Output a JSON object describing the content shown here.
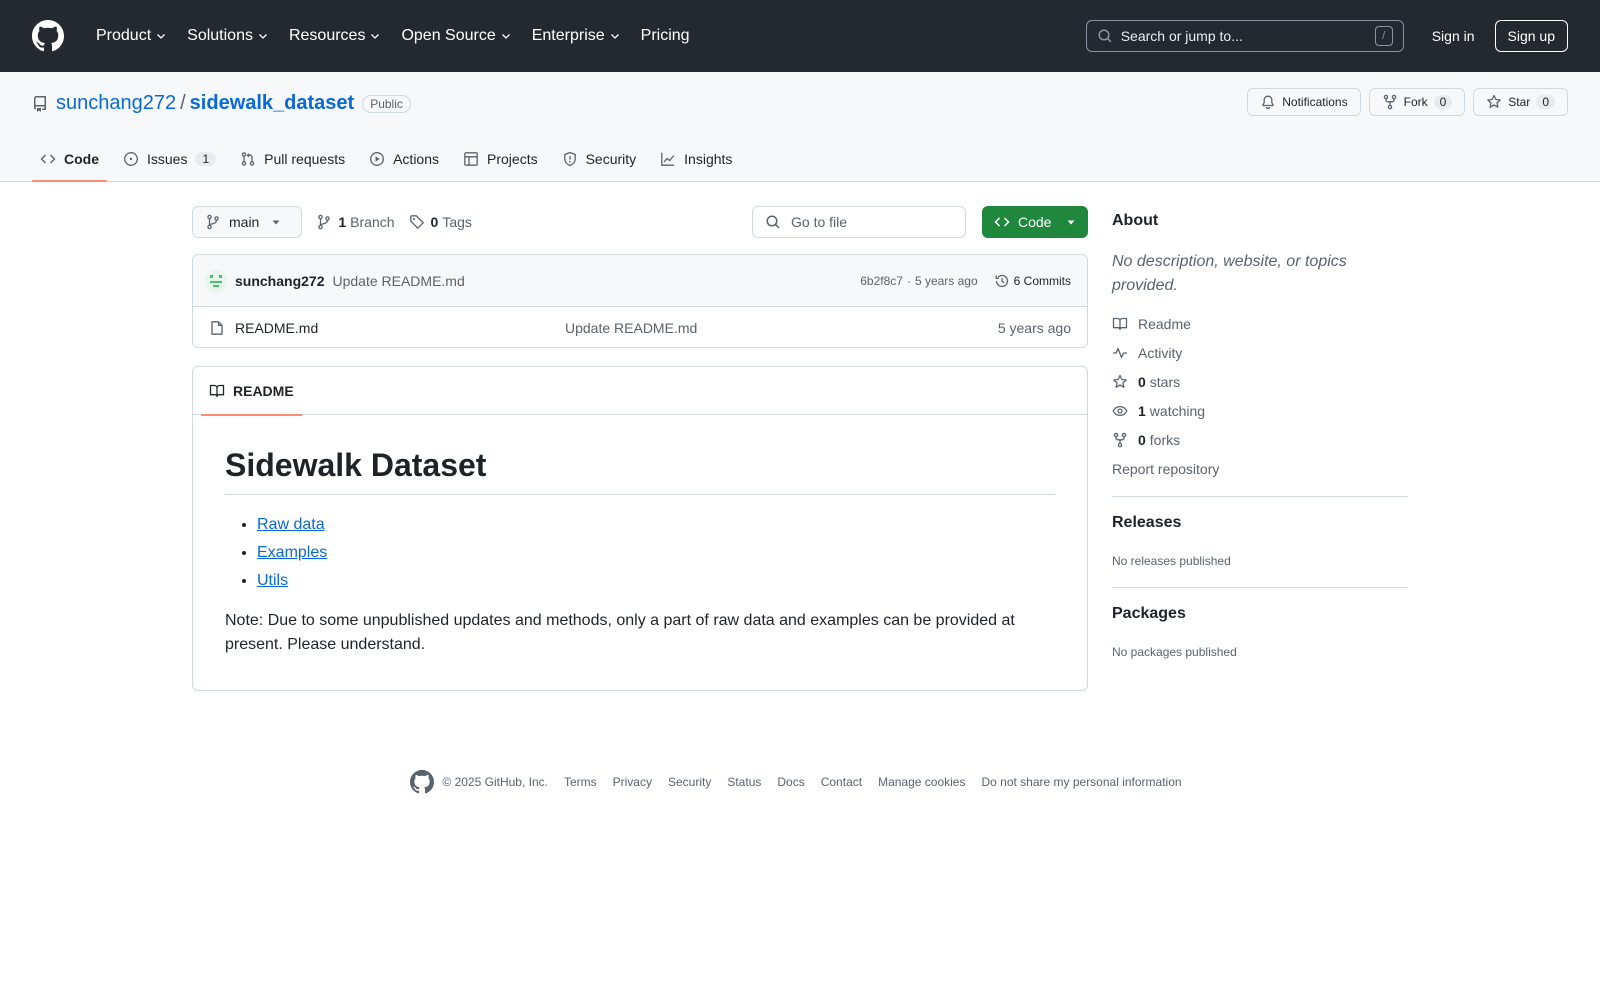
{
  "header": {
    "nav": [
      {
        "label": "Product",
        "has_menu": true
      },
      {
        "label": "Solutions",
        "has_menu": true
      },
      {
        "label": "Resources",
        "has_menu": true
      },
      {
        "label": "Open Source",
        "has_menu": true
      },
      {
        "label": "Enterprise",
        "has_menu": true
      },
      {
        "label": "Pricing",
        "has_menu": false
      }
    ],
    "search_placeholder": "Search or jump to...",
    "search_shortcut": "/",
    "sign_in": "Sign in",
    "sign_up": "Sign up"
  },
  "repo": {
    "owner": "sunchang272",
    "separator": "/",
    "name": "sidewalk_dataset",
    "visibility": "Public",
    "actions": {
      "notifications": "Notifications",
      "fork": "Fork",
      "fork_count": "0",
      "star": "Star",
      "star_count": "0"
    },
    "tabs": [
      {
        "label": "Code",
        "icon": "code-icon",
        "active": true,
        "count": ""
      },
      {
        "label": "Issues",
        "icon": "issue-icon",
        "active": false,
        "count": "1"
      },
      {
        "label": "Pull requests",
        "icon": "pull-request-icon",
        "active": false,
        "count": ""
      },
      {
        "label": "Actions",
        "icon": "play-icon",
        "active": false,
        "count": ""
      },
      {
        "label": "Projects",
        "icon": "table-icon",
        "active": false,
        "count": ""
      },
      {
        "label": "Security",
        "icon": "shield-icon",
        "active": false,
        "count": ""
      },
      {
        "label": "Insights",
        "icon": "graph-icon",
        "active": false,
        "count": ""
      }
    ]
  },
  "file_nav": {
    "branch": "main",
    "branch_count": "1",
    "branch_label": "Branch",
    "tag_count": "0",
    "tag_label": "Tags",
    "goto_placeholder": "Go to file",
    "code_button": "Code"
  },
  "commit": {
    "author": "sunchang272",
    "message": "Update README.md",
    "hash": "6b2f8c7",
    "dot": "·",
    "age": "5 years ago",
    "commits_label": "6 Commits"
  },
  "files": [
    {
      "name": "README.md",
      "message": "Update README.md",
      "age": "5 years ago"
    }
  ],
  "readme": {
    "tab_label": "README",
    "title": "Sidewalk Dataset",
    "links": [
      "Raw data",
      "Examples",
      "Utils"
    ],
    "note": "Note: Due to some unpublished updates and methods, only a part of raw data and examples can be provided at present. Please understand."
  },
  "sidebar": {
    "about_title": "About",
    "about_desc": "No description, website, or topics provided.",
    "readme": "Readme",
    "activity": "Activity",
    "stars_count": "0",
    "stars_label": "stars",
    "watching_count": "1",
    "watching_label": "watching",
    "forks_count": "0",
    "forks_label": "forks",
    "report": "Report repository",
    "releases_title": "Releases",
    "releases_empty": "No releases published",
    "packages_title": "Packages",
    "packages_empty": "No packages published"
  },
  "footer": {
    "copyright": "© 2025 GitHub, Inc.",
    "links": [
      "Terms",
      "Privacy",
      "Security",
      "Status",
      "Docs",
      "Contact",
      "Manage cookies",
      "Do not share my personal information"
    ]
  },
  "colors": {
    "header_bg": "#24292f",
    "link": "#0969da",
    "primary_button": "#1f883d",
    "active_tab_underline": "#fd8c73"
  }
}
